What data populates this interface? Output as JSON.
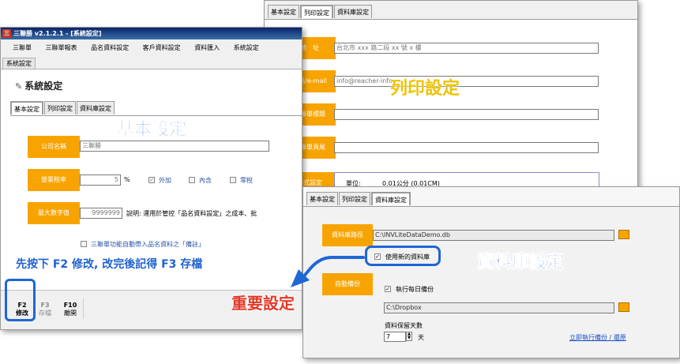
{
  "main_window": {
    "title": "三聯勝 v2.1.2.1 - [系統設定]",
    "app_icon": "三",
    "menu": [
      "三聯單",
      "三聯單報表",
      "品名資料設定",
      "客戶資料設定",
      "資料匯入",
      "系統設定"
    ],
    "doc_tab": "系統設定",
    "header": "系統設定",
    "tabs": [
      "基本設定",
      "列印設定",
      "資料庫設定"
    ],
    "company_label": "公司名稱",
    "company_value": "三聯勝",
    "tax_label": "營業稅率",
    "tax_value": "5",
    "tax_unit": "%",
    "tax_options": [
      {
        "label": "外加",
        "checked": true
      },
      {
        "label": "內含",
        "checked": false
      },
      {
        "label": "零稅",
        "checked": false
      }
    ],
    "max_label": "最大數字值",
    "max_value": "9999999",
    "max_desc": "說明: 運用於管控「品名資料設定」之成本、批",
    "auto_note_label": "三聯單功能自動帶入品名資料之「備註」",
    "fkeys": [
      {
        "key": "F2",
        "label": "修改"
      },
      {
        "key": "F3",
        "label": "存檔"
      },
      {
        "key": "F10",
        "label": "離開"
      }
    ]
  },
  "print_window": {
    "tabs": [
      "基本設定",
      "列印設定",
      "資料庫設定"
    ],
    "address_label": "地　址",
    "address_placeholder": "台北市 xxx 路二段 xx 號 x 樓",
    "phone_label": "電話/e-mail",
    "phone_placeholder": "info@reacher-info",
    "header_label": "三聯單標題",
    "footer_label": "三聯單頁尾",
    "format_label": "格式設定",
    "unit_label": "單位:",
    "unit_value": "0.01公分 (0.01CM)"
  },
  "db_window": {
    "tabs": [
      "基本設定",
      "列印設定",
      "資料庫設定"
    ],
    "path_label": "資料庫路徑",
    "path_value": "C:\\INVLiteDataDemo.db",
    "use_new_db_label": "使用新的資料庫",
    "backup_label": "自動備份",
    "daily_backup_label": "執行每日備份",
    "backup_path": "C:\\Dropbox",
    "keep_days_label": "資料保留天數",
    "keep_days_value": "7",
    "keep_days_unit": "天",
    "backup_now_link": "立即執行備份 / 還原"
  },
  "annotations": {
    "basic": "基本設定",
    "print": "列印設定",
    "database": "資料庫設定",
    "important": "重要設定",
    "note": "先按下 F2 修改, 改完後記得 F3 存檔"
  },
  "colors": {
    "accent_orange": "#f8a400",
    "annotation_blue": "#1f64d2",
    "annotation_yellow": "#f0c400",
    "annotation_red": "#e23a2a"
  }
}
